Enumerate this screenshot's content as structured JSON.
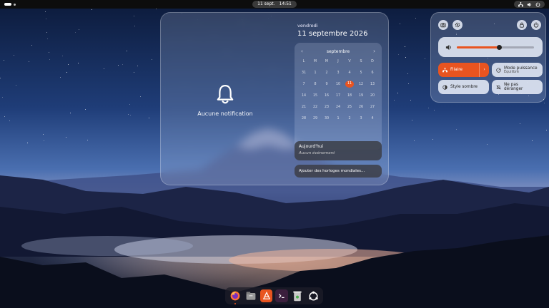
{
  "topbar": {
    "clock_date": "11 sept.",
    "clock_time": "14:51",
    "activities_icon": "activities-pill-icon",
    "system_icons": [
      "network-icon",
      "volume-icon",
      "power-icon"
    ]
  },
  "notifications": {
    "icon": "bell-icon",
    "empty_text": "Aucune notification"
  },
  "calendar": {
    "weekday": "vendredi",
    "full_date": "11 septembre 2026",
    "month": "septembre",
    "prev_icon": "chevron-left-icon",
    "next_icon": "chevron-right-icon",
    "day_headers": [
      "L",
      "M",
      "M",
      "J",
      "V",
      "S",
      "D"
    ],
    "weeks": [
      [
        "31",
        "1",
        "2",
        "3",
        "4",
        "5",
        "6"
      ],
      [
        "7",
        "8",
        "9",
        "10",
        "11",
        "12",
        "13"
      ],
      [
        "14",
        "15",
        "16",
        "17",
        "18",
        "19",
        "20"
      ],
      [
        "21",
        "22",
        "23",
        "24",
        "25",
        "26",
        "27"
      ],
      [
        "28",
        "29",
        "30",
        "1",
        "2",
        "3",
        "4"
      ]
    ],
    "today": "11",
    "today_card_title": "Aujourd'hui",
    "today_card_sub": "Aucun événement",
    "world_clocks_label": "Ajouter des horloges mondiales…"
  },
  "quick_settings": {
    "top_left_icons": [
      "screenshot-icon",
      "settings-icon"
    ],
    "top_right_icons": [
      "lock-icon",
      "power-icon"
    ],
    "volume_icon": "volume-icon",
    "volume_level": 0.55,
    "tiles": {
      "wired_label": "Filaire",
      "power_mode_label": "Mode puissance",
      "power_mode_sub": "Équilibré",
      "dark_style_label": "Style sombre",
      "dnd_label": "Ne pas déranger"
    }
  },
  "dock": {
    "apps": [
      "firefox-icon",
      "files-icon",
      "app-center-icon",
      "terminal-icon",
      "trash-icon",
      "show-apps-icon"
    ]
  },
  "colors": {
    "accent": "#e95420",
    "topbar": "#0d0d0d"
  }
}
